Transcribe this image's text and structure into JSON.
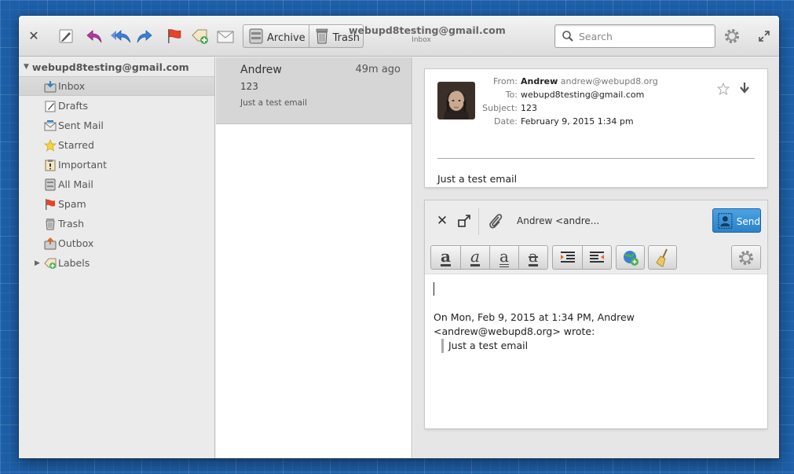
{
  "window": {
    "title": "webupd8testing@gmail.com",
    "subtitle": "Inbox"
  },
  "toolbar": {
    "close_icon": "close-icon",
    "buttons": [
      "compose",
      "reply",
      "reply-all",
      "forward",
      "flag",
      "add-label",
      "move-to"
    ],
    "archive_label": "Archive",
    "trash_label": "Trash"
  },
  "search": {
    "placeholder": "Search"
  },
  "sidebar": {
    "account": "webupd8testing@gmail.com",
    "folders": [
      {
        "label": "Inbox",
        "icon": "inbox-icon"
      },
      {
        "label": "Drafts",
        "icon": "drafts-icon"
      },
      {
        "label": "Sent Mail",
        "icon": "sent-mail-icon"
      },
      {
        "label": "Starred",
        "icon": "star-icon"
      },
      {
        "label": "Important",
        "icon": "important-icon"
      },
      {
        "label": "All Mail",
        "icon": "all-mail-icon"
      },
      {
        "label": "Spam",
        "icon": "spam-flag-icon"
      },
      {
        "label": "Trash",
        "icon": "trash-icon"
      },
      {
        "label": "Outbox",
        "icon": "outbox-icon"
      },
      {
        "label": "Labels",
        "icon": "labels-icon"
      }
    ]
  },
  "messages": [
    {
      "from": "Andrew",
      "time": "49m ago",
      "subject": "123",
      "preview": "Just a test email"
    }
  ],
  "email": {
    "from_key": "From:",
    "from_name": "Andrew",
    "from_addr": "andrew@webupd8.org",
    "to_key": "To:",
    "to": "webupd8testing@gmail.com",
    "subject_key": "Subject:",
    "subject": "123",
    "date_key": "Date:",
    "date": "February 9, 2015 1:34 pm",
    "body": "Just a test email"
  },
  "composer": {
    "recipient": "Andrew <andre...",
    "send_label": "Send",
    "quote_header": "On Mon, Feb 9, 2015 at 1:34 PM, Andrew <andrew@webupd8.org> wrote:",
    "quote_body": "Just a test email",
    "format_bold": "a",
    "format_italic": "a",
    "format_underline": "a",
    "format_strike": "a"
  },
  "colors": {
    "accent": "#2d82c9",
    "flag": "#e5432b",
    "arrows": "#3a7fd5",
    "reply": "#b03a9e"
  }
}
